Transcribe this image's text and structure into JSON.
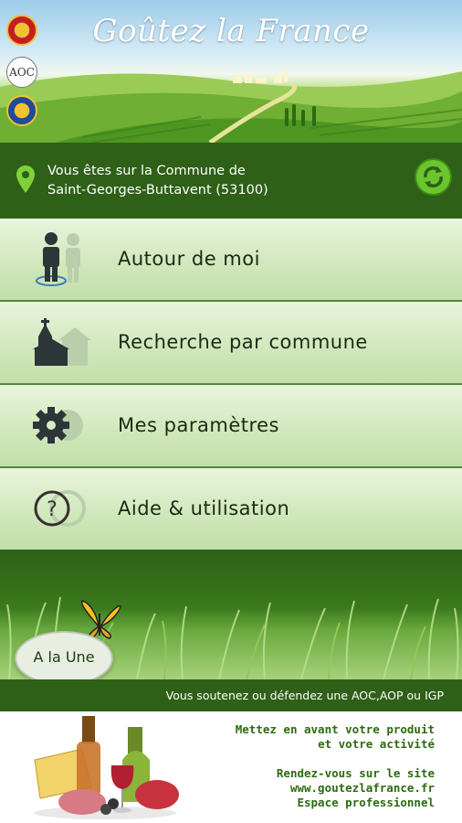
{
  "app": {
    "title": "Goûtez la France",
    "badges": [
      "aop-badge",
      "aoc-badge",
      "igp-badge"
    ],
    "aoc_badge_text": "AOC"
  },
  "location": {
    "line1": "Vous êtes sur la Commune de",
    "line2": "Saint-Georges-Buttavent (53100)"
  },
  "menu": {
    "items": [
      {
        "label": "Autour de moi",
        "icon": "person-location-icon"
      },
      {
        "label": "Recherche par commune",
        "icon": "church-icon"
      },
      {
        "label": "Mes paramètres",
        "icon": "gear-icon"
      },
      {
        "label": "Aide & utilisation",
        "icon": "help-icon"
      }
    ]
  },
  "news": {
    "button_label": "A la Une"
  },
  "support": {
    "text": "Vous soutenez ou défendez une AOC,AOP ou IGP"
  },
  "promo": {
    "line1": "Mettez en avant votre produit",
    "line2": "et votre activité",
    "line3": "Rendez-vous sur le site",
    "line4": "www.goutezlafrance.fr",
    "line5": "Espace professionnel"
  },
  "colors": {
    "dark_green": "#2e6017",
    "menu_bg": "#cfe7ba",
    "refresh_green": "#6bc62e"
  }
}
